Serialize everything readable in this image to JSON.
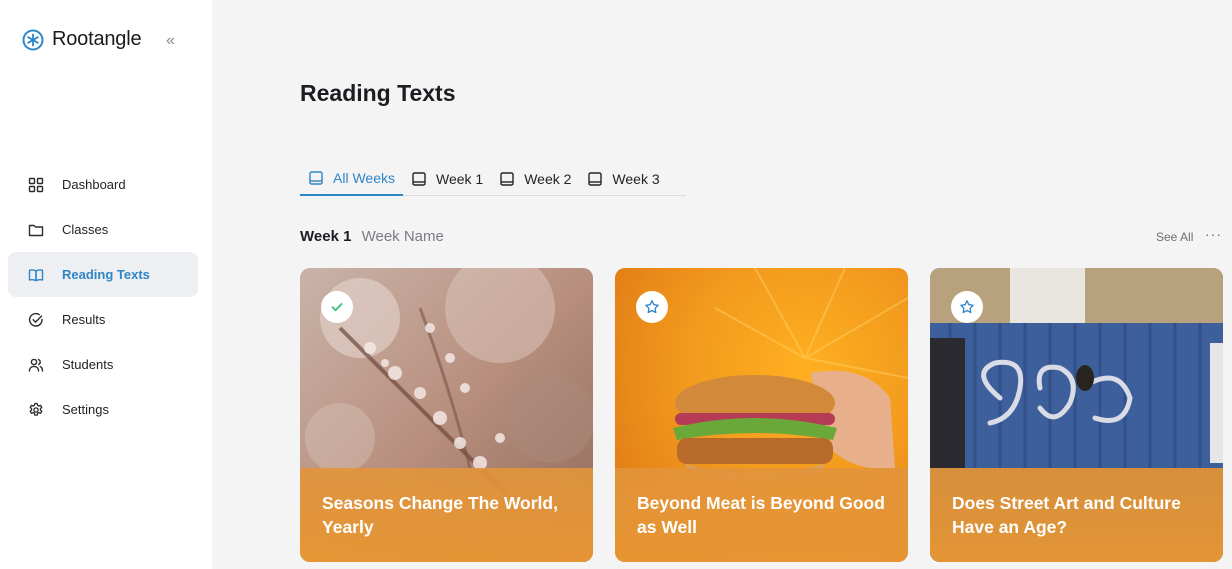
{
  "brand": {
    "name": "Rootangle",
    "icon": "snowflake-logo-icon",
    "accent": "#2f86c7"
  },
  "sidebar": {
    "collapse_label": "«",
    "items": [
      {
        "label": "Dashboard",
        "icon": "grid-icon",
        "active": false
      },
      {
        "label": "Classes",
        "icon": "folder-icon",
        "active": false
      },
      {
        "label": "Reading Texts",
        "icon": "open-book-icon",
        "active": true
      },
      {
        "label": "Results",
        "icon": "check-circle-icon",
        "active": false
      },
      {
        "label": "Students",
        "icon": "users-icon",
        "active": false
      },
      {
        "label": "Settings",
        "icon": "gear-icon",
        "active": false
      }
    ]
  },
  "main": {
    "title": "Reading Texts",
    "tabs": [
      {
        "label": "All Weeks",
        "active": true
      },
      {
        "label": "Week 1",
        "active": false
      },
      {
        "label": "Week 2",
        "active": false
      },
      {
        "label": "Week 3",
        "active": false
      }
    ],
    "section": {
      "week": "Week 1",
      "name": "Week Name",
      "see_all": "See All",
      "more": "···"
    },
    "cards": [
      {
        "title": "Seasons Change The World, Yearly",
        "status": "completed",
        "badge_icon": "check-icon"
      },
      {
        "title": "Beyond Meat is Beyond Good as Well",
        "status": "not-started",
        "badge_icon": "star-outline-icon"
      },
      {
        "title": "Does Street Art and Culture Have an Age?",
        "status": "not-started",
        "badge_icon": "star-outline-icon"
      }
    ]
  },
  "colors": {
    "accent": "#2f86c7",
    "card_overlay": "#e7963a",
    "check": "#3bbf73",
    "active_nav_bg": "#eeeff2"
  }
}
